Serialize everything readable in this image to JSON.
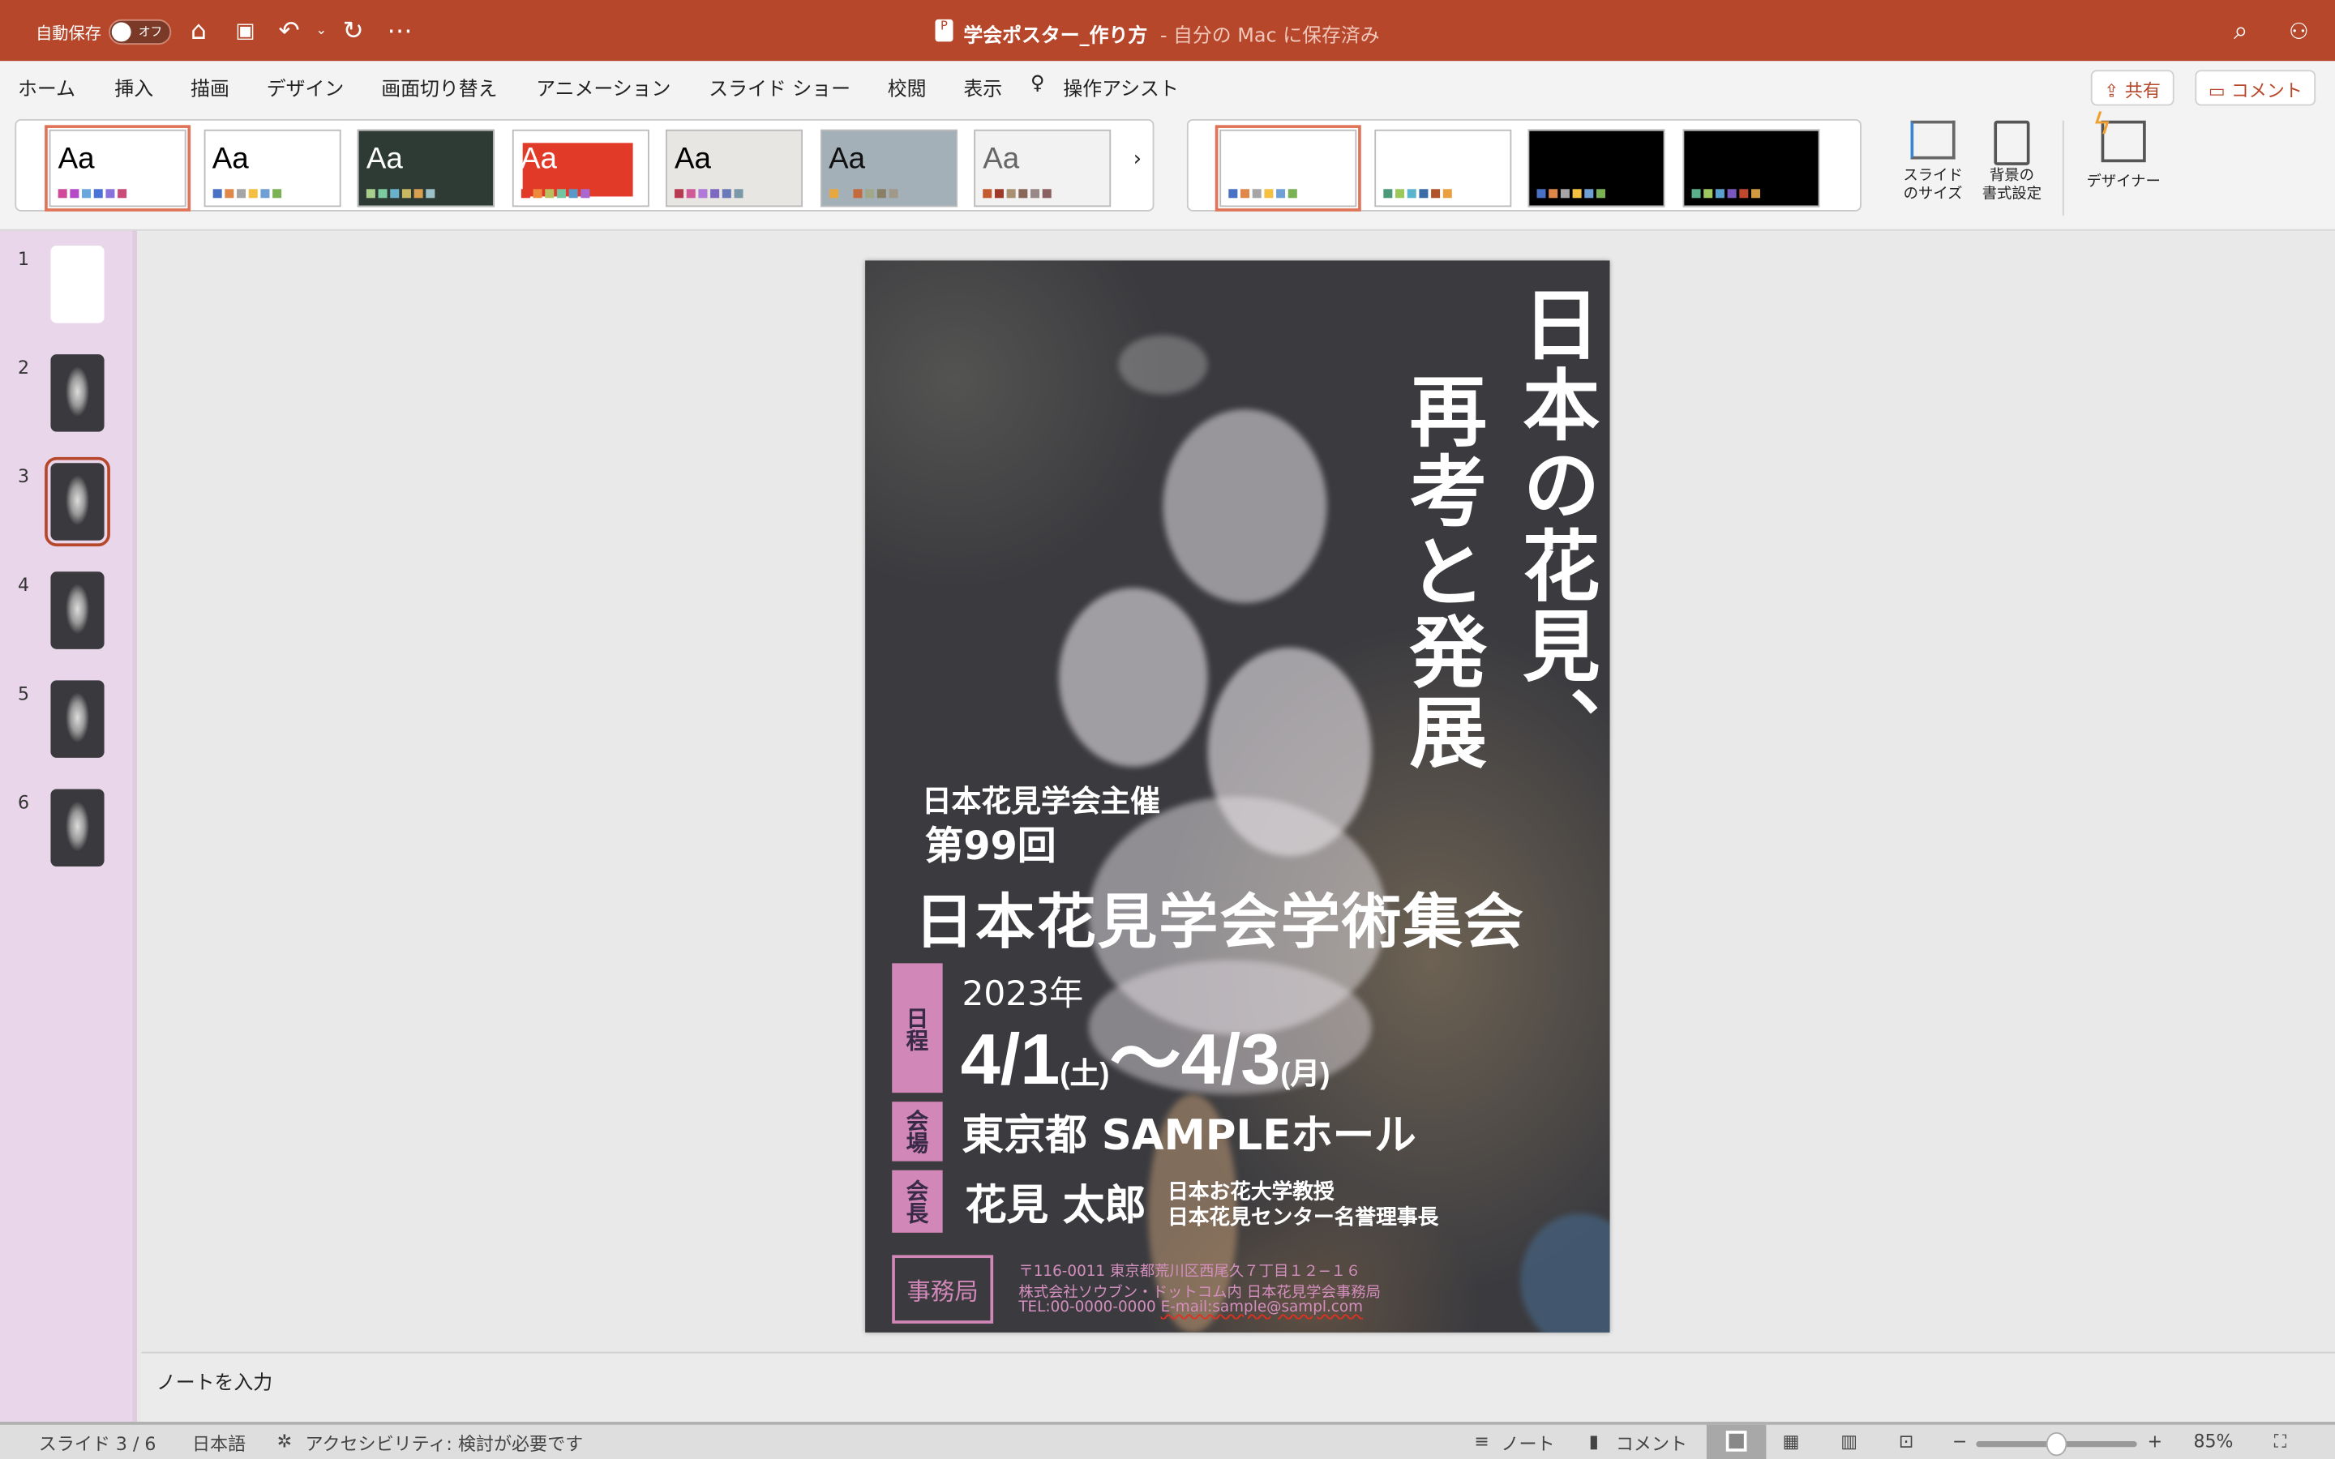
{
  "titlebar": {
    "autosave_label": "自動保存",
    "autosave_state": "オフ",
    "doc_title": "学会ポスター_作り方",
    "save_status": "- 自分の Mac に保存済み",
    "icons": [
      "home-icon",
      "save-icon",
      "undo-icon",
      "redo-icon",
      "more-icon",
      "search-icon",
      "account-icon"
    ]
  },
  "tabs": [
    {
      "label": "ホーム"
    },
    {
      "label": "挿入"
    },
    {
      "label": "描画"
    },
    {
      "label": "デザイン",
      "active": true
    },
    {
      "label": "画面切り替え"
    },
    {
      "label": "アニメーション"
    },
    {
      "label": "スライド ショー"
    },
    {
      "label": "校閲"
    },
    {
      "label": "表示"
    },
    {
      "label": "操作アシスト"
    }
  ],
  "actions": {
    "share": "共有",
    "comment": "コメント"
  },
  "ribbon": {
    "theme_label": "Aa",
    "slide_size": [
      "スライド",
      "のサイズ"
    ],
    "format_bg": [
      "背景の",
      "書式設定"
    ],
    "designer": "デザイナー",
    "themes": [
      {
        "bg": "#ffffff",
        "fg": "#000",
        "colors": [
          "#d04a9a",
          "#b44ac8",
          "#6aa7dc",
          "#4a73d8",
          "#8a72dc",
          "#c84a78"
        ]
      },
      {
        "bg": "#ffffff",
        "fg": "#000",
        "colors": [
          "#4a72c4",
          "#e0884a",
          "#a5a5a5",
          "#f4c042",
          "#6ea0d6",
          "#7cb256"
        ]
      },
      {
        "bg": "#2e3a34",
        "fg": "#fff",
        "colors": [
          "#a8d08c",
          "#7ccaa0",
          "#6ab2cc",
          "#c8b862",
          "#d8a050",
          "#9cc0c8"
        ]
      },
      {
        "bg": "#ffffff",
        "fg": "#fff",
        "colors": [
          "#e23a28",
          "#ee8a3c",
          "#b8c060",
          "#74c4a4",
          "#5a98c8",
          "#a86ad0"
        ]
      },
      {
        "bg": "#e8e6e2",
        "fg": "#000",
        "colors": [
          "#b83a50",
          "#d05a98",
          "#b078d8",
          "#7c68c0",
          "#6a7ab8",
          "#7a98a8"
        ]
      },
      {
        "bg": "#a4b0b8",
        "fg": "#111",
        "colors": [
          "#e8a840",
          "#a4b0b8",
          "#c46a3c",
          "#a0a888",
          "#8a8068",
          "#a09888"
        ]
      },
      {
        "bg": "#f2f2f2",
        "fg": "#666",
        "colors": [
          "#c45a30",
          "#a03a28",
          "#a89070",
          "#8a6858",
          "#988888",
          "#8a6060"
        ]
      }
    ],
    "variants": [
      {
        "bg": "#ffffff",
        "colors": [
          "#4a72c4",
          "#e0884a",
          "#a5a5a5",
          "#f4c042",
          "#6ea0d6",
          "#7cb256"
        ]
      },
      {
        "bg": "#ffffff",
        "colors": [
          "#4a9a78",
          "#9cc85a",
          "#5ab4cc",
          "#3a6ca8",
          "#b0542a",
          "#e8a040"
        ]
      },
      {
        "bg": "#000000",
        "colors": [
          "#4a72c4",
          "#e0884a",
          "#a5a5a5",
          "#f4c042",
          "#6ea0d6",
          "#7cb256"
        ]
      },
      {
        "bg": "#000000",
        "colors": [
          "#5ab08a",
          "#a0c860",
          "#5aa0cc",
          "#7a58c0",
          "#c0482e",
          "#d09a40"
        ]
      }
    ]
  },
  "slides": [
    {
      "num": "1"
    },
    {
      "num": "2"
    },
    {
      "num": "3",
      "selected": true
    },
    {
      "num": "4"
    },
    {
      "num": "5"
    },
    {
      "num": "6"
    }
  ],
  "poster": {
    "title_col1": "日本の花見、",
    "title_col2": "再考と発展",
    "host": "日本花見学会主催",
    "edition": "第99回",
    "event": "日本花見学会学術集会",
    "schedule_label": "日程",
    "year": "2023年",
    "date_start": "4/1",
    "day_start": "(土)",
    "tilde": "〜",
    "date_end": "4/3",
    "day_end": "(月)",
    "venue_label": "会場",
    "venue": "東京都 SAMPLEホール",
    "chair_label": "会長",
    "chair_name": "花見 太郎",
    "chair_title1": "日本お花大学教授",
    "chair_title2": "日本花見センター名誉理事長",
    "office_label": "事務局",
    "address": "〒116-0011 東京都荒川区西尾久７丁目１２−１６",
    "org": "株式会社ソウブン・ドットコム内 日本花見学会事務局",
    "tel": "TEL:00-0000-0000",
    "email": "E-mail:sample@sampl.com"
  },
  "notes_placeholder": "ノートを入力",
  "status": {
    "slide": "スライド 3 / 6",
    "language": "日本語",
    "accessibility": "アクセシビリティ: 検討が必要です",
    "notes": "ノート",
    "comments": "コメント",
    "zoom": "85%",
    "zoom_fraction": 0.5
  },
  "colors": {
    "accent": "#b7472a",
    "label_pink": "#d187b7",
    "slide_bg": "#3b3b3f"
  }
}
